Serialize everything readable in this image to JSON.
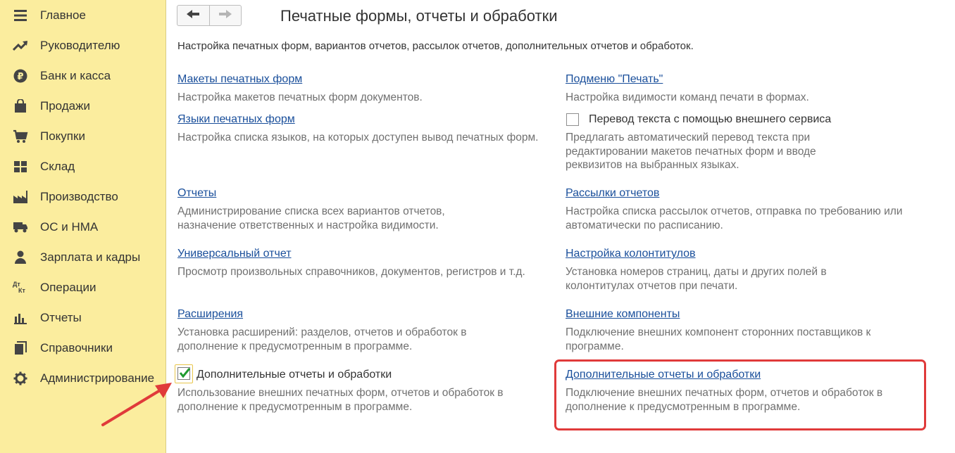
{
  "sidebar": {
    "items": [
      {
        "label": "Главное",
        "icon": "menu-lines-icon"
      },
      {
        "label": "Руководителю",
        "icon": "trend-up-icon"
      },
      {
        "label": "Банк и касса",
        "icon": "ruble-icon"
      },
      {
        "label": "Продажи",
        "icon": "shopping-bag-icon"
      },
      {
        "label": "Покупки",
        "icon": "cart-icon"
      },
      {
        "label": "Склад",
        "icon": "warehouse-grid-icon"
      },
      {
        "label": "Производство",
        "icon": "factory-icon"
      },
      {
        "label": "ОС и НМА",
        "icon": "truck-icon"
      },
      {
        "label": "Зарплата и кадры",
        "icon": "person-icon"
      },
      {
        "label": "Операции",
        "icon": "dt-kt-icon"
      },
      {
        "label": "Отчеты",
        "icon": "bar-chart-icon"
      },
      {
        "label": "Справочники",
        "icon": "books-icon"
      },
      {
        "label": "Администрирование",
        "icon": "gear-icon"
      }
    ],
    "dtkt_text": "Дт",
    "dtkt_text2": "Кт"
  },
  "header": {
    "title": "Печатные формы, отчеты и обработки",
    "subtitle": "Настройка печатных форм, вариантов отчетов, рассылок отчетов, дополнительных отчетов и обработок.",
    "back_icon": "arrow-left-icon",
    "forward_icon": "arrow-right-icon"
  },
  "left": {
    "print_layouts": {
      "link": "Макеты печатных форм",
      "desc": "Настройка макетов печатных форм документов."
    },
    "print_languages": {
      "link": "Языки печатных форм",
      "desc": "Настройка списка языков, на которых доступен вывод печатных форм."
    },
    "reports": {
      "link": "Отчеты",
      "desc": "Администрирование списка всех вариантов отчетов, назначение ответственных и настройка видимости."
    },
    "universal_report": {
      "link": "Универсальный отчет",
      "desc": "Просмотр произвольных справочников, документов, регистров и т.д."
    },
    "extensions": {
      "link": "Расширения",
      "desc": "Установка расширений: разделов, отчетов и обработок в дополнение к предусмотренным в программе."
    },
    "additional": {
      "label": "Дополнительные отчеты и обработки",
      "checked": true,
      "desc": "Использование внешних печатных форм, отчетов и обработок в дополнение к предусмотренным в программе."
    }
  },
  "right": {
    "print_submenu": {
      "link": "Подменю \"Печать\"",
      "desc": "Настройка видимости команд печати в формах."
    },
    "translation": {
      "label": "Перевод текста с помощью внешнего сервиса",
      "checked": false,
      "desc": "Предлагать автоматический перевод текста при редактировании макетов печатных форм и вводе реквизитов на выбранных языках."
    },
    "mailings": {
      "link": "Рассылки отчетов",
      "desc": "Настройка списка рассылок отчетов, отправка по требованию или автоматически по расписанию."
    },
    "headers_footers": {
      "link": "Настройка колонтитулов",
      "desc": "Установка номеров страниц, даты и других полей в колонтитулах отчетов при печати."
    },
    "external_components": {
      "link": "Внешние компоненты",
      "desc": "Подключение внешних компонент сторонних поставщиков к программе."
    },
    "additional": {
      "link": "Дополнительные отчеты и обработки",
      "desc": "Подключение внешних печатных форм, отчетов и обработок в дополнение к предусмотренным в программе."
    }
  },
  "colors": {
    "sidebar_bg": "#fbed9e",
    "link": "#1a4f9b",
    "highlight": "#e03a3a",
    "check": "#1f9a2f"
  }
}
